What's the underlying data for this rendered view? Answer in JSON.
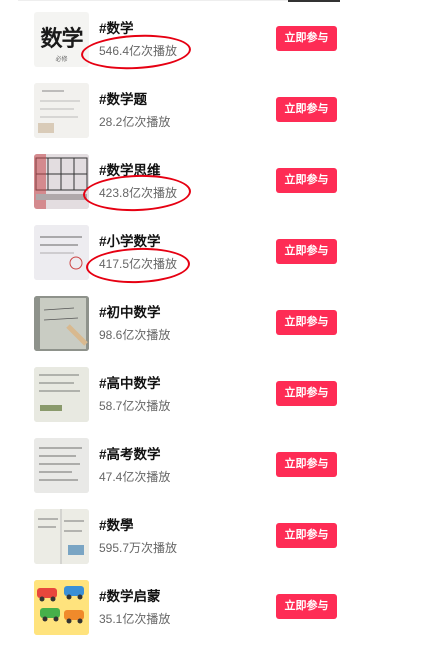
{
  "join_label": "立即参与",
  "accent_color": "#fe2c55",
  "items": [
    {
      "hashtag": "#数学",
      "views": "546.4亿次播放",
      "thumb_text": "数学",
      "thumb_sub": "必修",
      "circled": true
    },
    {
      "hashtag": "#数学题",
      "views": "28.2亿次播放",
      "circled": false
    },
    {
      "hashtag": "#数学思维",
      "views": "423.8亿次播放",
      "circled": true
    },
    {
      "hashtag": "#小学数学",
      "views": "417.5亿次播放",
      "circled": true
    },
    {
      "hashtag": "#初中数学",
      "views": "98.6亿次播放",
      "circled": false
    },
    {
      "hashtag": "#高中数学",
      "views": "58.7亿次播放",
      "circled": false
    },
    {
      "hashtag": "#高考数学",
      "views": "47.4亿次播放",
      "circled": false
    },
    {
      "hashtag": "#数學",
      "views": "595.7万次播放",
      "circled": false
    },
    {
      "hashtag": "#数学启蒙",
      "views": "35.1亿次播放",
      "circled": false
    }
  ]
}
